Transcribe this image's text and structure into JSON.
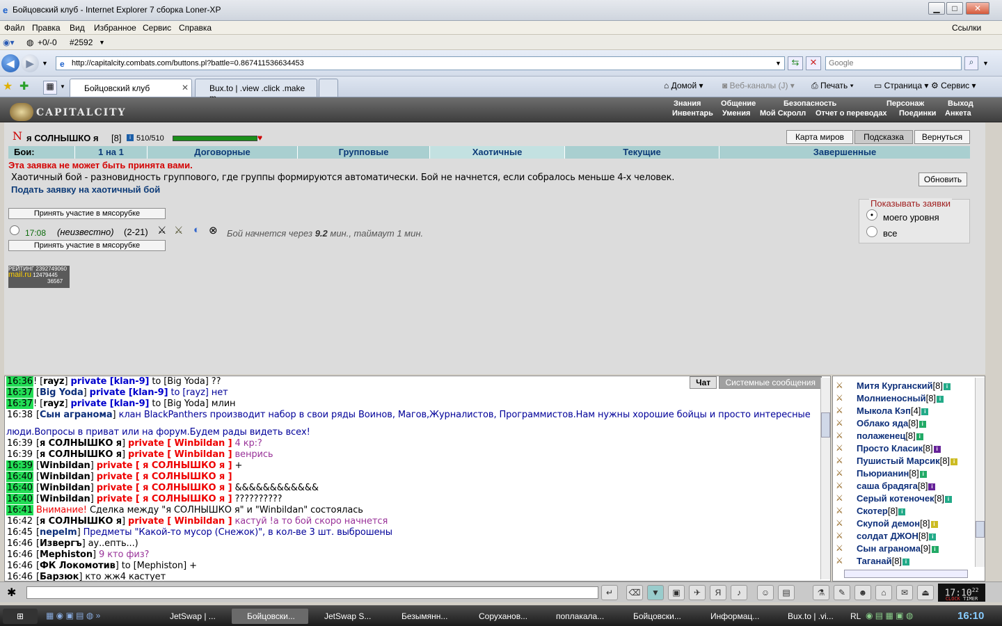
{
  "window": {
    "title": "Бойцовский клуб - Internet Explorer 7 сборка Loner-XP",
    "min": "▁",
    "max": "□",
    "close": "✕"
  },
  "menu": [
    "Файл",
    "Правка",
    "Вид",
    "Избранное",
    "Сервис",
    "Справка"
  ],
  "menu_links": "Ссылки",
  "toolbar1": {
    "counter": "+0/-0",
    "id": "#2592"
  },
  "address": {
    "url": "http://capitalcity.combats.com/buttons.pl?battle=0.867411536634453",
    "search_placeholder": "Google"
  },
  "tabs": [
    {
      "label": "Бойцовский клуб",
      "active": true
    },
    {
      "label": "Bux.to | .view .click .make m...",
      "active": false
    }
  ],
  "tab_commands": [
    "Домой",
    "Веб-каналы (J)",
    "Печать",
    "Страница",
    "Сервис"
  ],
  "game": {
    "logo": "CAPITALCITY",
    "topmenu": [
      "Знания",
      "Общение",
      "Безопасность",
      "Персонаж",
      "Выход"
    ],
    "submenu": [
      "Инвентарь",
      "Умения",
      "Мой Скролл",
      "Отчет о переводах",
      "Поединки",
      "Анкета"
    ],
    "player": {
      "name": "я СОЛНЫШКО я",
      "level": "[8]",
      "hp": "510/510",
      "hp_fraction": 1.0
    },
    "right_buttons": [
      "Карта миров",
      "Подсказка",
      "Вернуться"
    ],
    "fight_tabs": [
      "Бои:",
      "1 на 1",
      "Договорные",
      "Групповые",
      "Хаотичные",
      "Текущие",
      "Завершенные"
    ],
    "warning": "Эта заявка не может быть принята вами.",
    "description": "Хаотичный бой - разновидность группового, где группы формируются автоматически. Бой не начнется, если собралось меньше 4-х человек.",
    "refresh_button": "Обновить",
    "submit_link": "Подать заявку на хаотичный бой",
    "join_button": "Принять участие в мясорубке",
    "battle": {
      "time": "17:08",
      "who": "(неизвестно)",
      "levels": "(2-21)",
      "status_prefix": "Бой начнется через",
      "minutes": "9.2",
      "status_suffix": "мин., таймаут 1 мин."
    },
    "show_filter": {
      "legend": "Показывать заявки",
      "opt1": "моего уровня",
      "opt2": "все"
    },
    "counter_badge": {
      "label": "РЕЙТИНГ",
      "brand": "mail.ru",
      "n1": "2392749060",
      "n2": "12479445",
      "n3": "36567"
    }
  },
  "chat_tabs": [
    "Чат",
    "Системные сообщения"
  ],
  "chat": [
    {
      "time": "16:36",
      "hl": true,
      "pre": "! [",
      "nick": "rayz",
      "post": "] ",
      "priv": "private [klan-9]",
      "privcls": "pv-blue",
      "text": " to [Big Yoda] ??",
      "cls": ""
    },
    {
      "time": "16:37",
      "hl": true,
      "pre": " [",
      "nick": "Big Yoda",
      "post": "] ",
      "priv": "private [klan-9]",
      "privcls": "pv-blue",
      "text": " to [rayz] нет",
      "cls": "blue"
    },
    {
      "time": "16:37",
      "hl": true,
      "pre": "! [",
      "nick": "rayz",
      "post": "] ",
      "priv": "private [klan-9]",
      "privcls": "pv-blue",
      "text": " to [Big Yoda] млин",
      "cls": ""
    },
    {
      "time": "16:38",
      "hl": false,
      "pre": " [",
      "nick": "Сын агранома",
      "post": "] ",
      "priv": "",
      "privcls": "",
      "text": "клан BlackPanthers производит набор в свои ряды Воинов, Магов,Журналистов, Программистов.Нам нужны хорошие бойцы и просто интересные",
      "cls": "blue"
    },
    {
      "time": "",
      "hl": false,
      "pre": "",
      "nick": "",
      "post": "",
      "priv": "",
      "privcls": "",
      "text": "люди.Вопросы в приват или на форум.Будем рады видеть всех!",
      "cls": "blue"
    },
    {
      "time": "16:39",
      "hl": false,
      "pre": " [",
      "nick": "я СОЛНЫШКО я",
      "post": "] ",
      "priv": "private [ Winbildan ]",
      "privcls": "priv",
      "text": " 4 кр:?",
      "cls": "purple"
    },
    {
      "time": "16:39",
      "hl": false,
      "pre": " [",
      "nick": "я СОЛНЫШКО я",
      "post": "] ",
      "priv": "private [ Winbildan ]",
      "privcls": "priv",
      "text": " венрись",
      "cls": "purple"
    },
    {
      "time": "16:39",
      "hl": true,
      "pre": " [",
      "nick": "Winbildan",
      "post": "] ",
      "priv": "private [ я СОЛНЫШКО я ]",
      "privcls": "priv",
      "text": " +",
      "cls": ""
    },
    {
      "time": "16:40",
      "hl": true,
      "pre": " [",
      "nick": "Winbildan",
      "post": "] ",
      "priv": "private [ я СОЛНЫШКО я ]",
      "privcls": "priv",
      "text": "",
      "cls": ""
    },
    {
      "time": "16:40",
      "hl": true,
      "pre": " [",
      "nick": "Winbildan",
      "post": "] ",
      "priv": "private [ я СОЛНЫШКО я ]",
      "privcls": "priv",
      "text": " &&&&&&&&&&&&",
      "cls": ""
    },
    {
      "time": "16:40",
      "hl": true,
      "pre": " [",
      "nick": "Winbildan",
      "post": "] ",
      "priv": "private [ я СОЛНЫШКО я ]",
      "privcls": "priv",
      "text": " ??????????",
      "cls": ""
    },
    {
      "time": "16:41",
      "hl": true,
      "pre": " ",
      "nick": "",
      "post": "",
      "priv": "Внимание!",
      "privcls": "priv-light",
      "text": " Сделка между \"я СОЛНЫШКО я\" и \"Winbildan\" состоялась",
      "cls": ""
    },
    {
      "time": "16:42",
      "hl": false,
      "pre": " [",
      "nick": "я СОЛНЫШКО я",
      "post": "] ",
      "priv": "private [ Winbildan ]",
      "privcls": "priv",
      "text": " кастуй !а то бой скоро начнется",
      "cls": "purple"
    },
    {
      "time": "16:45",
      "hl": false,
      "pre": " [",
      "nick": "nepelm",
      "post": "] ",
      "priv": "",
      "privcls": "",
      "text": "Предметы \"Какой-то мусор (Снежок)\", в кол-ве 3 шт. выброшены",
      "cls": "blue"
    },
    {
      "time": "16:46",
      "hl": false,
      "pre": " [",
      "nick": "Извергъ",
      "post": "] ",
      "priv": "",
      "privcls": "",
      "text": "ау..епть...)",
      "cls": ""
    },
    {
      "time": "16:46",
      "hl": false,
      "pre": " [",
      "nick": "Mephiston",
      "post": "] ",
      "priv": "",
      "privcls": "",
      "text": "9 кто физ?",
      "cls": "purple"
    },
    {
      "time": "16:46",
      "hl": false,
      "pre": " [",
      "nick": "ФК Локомотив",
      "post": "] ",
      "priv": "",
      "privcls": "",
      "text": "to [Mephiston] +",
      "cls": ""
    },
    {
      "time": "16:46",
      "hl": false,
      "pre": " [",
      "nick": "Барзюк",
      "post": "] ",
      "priv": "",
      "privcls": "",
      "text": "кто жж4 кастует",
      "cls": ""
    }
  ],
  "users": [
    {
      "name": "Митя Курганский",
      "lvl": "[8]",
      "color": "#2a8"
    },
    {
      "name": "Молниеносный",
      "lvl": "[8]",
      "color": "#2a8"
    },
    {
      "name": "Мыкола Кэп",
      "lvl": "[4]",
      "color": "#2a8"
    },
    {
      "name": "Облако яда",
      "lvl": "[8]",
      "color": "#2a6"
    },
    {
      "name": "полаженец",
      "lvl": "[8]",
      "color": "#2a6"
    },
    {
      "name": "Просто Класик",
      "lvl": "[8]",
      "color": "#629"
    },
    {
      "name": "Пушистый Марсик",
      "lvl": "[8]",
      "color": "#cb2"
    },
    {
      "name": "Пьюрианин",
      "lvl": "[8]",
      "color": "#2a6"
    },
    {
      "name": "саша брадяга",
      "lvl": "[8]",
      "color": "#629"
    },
    {
      "name": "Серый котеночек",
      "lvl": "[8]",
      "color": "#2a8"
    },
    {
      "name": "Скотер",
      "lvl": "[8]",
      "color": "#2a8"
    },
    {
      "name": "Скупой демон",
      "lvl": "[8]",
      "color": "#cb2"
    },
    {
      "name": "солдат ДЖОН",
      "lvl": "[8]",
      "color": "#2a8"
    },
    {
      "name": "Сын агранома",
      "lvl": "[9]",
      "color": "#2a6"
    },
    {
      "name": "Таганай",
      "lvl": "[8]",
      "color": "#2a8"
    }
  ],
  "clock": {
    "time": "17:10",
    "sec": "22",
    "label1": "CLOCK",
    "label2": "TIMER"
  },
  "taskbar": {
    "items": [
      "JetSwap | ...",
      "Бойцовски...",
      "JetSwap S...",
      "Безымянн...",
      "Соруханов...",
      "поплакала...",
      "Бойцовски...",
      "Информац...",
      "Bux.to | .vi..."
    ],
    "lang": "RL",
    "time": "16:10"
  }
}
